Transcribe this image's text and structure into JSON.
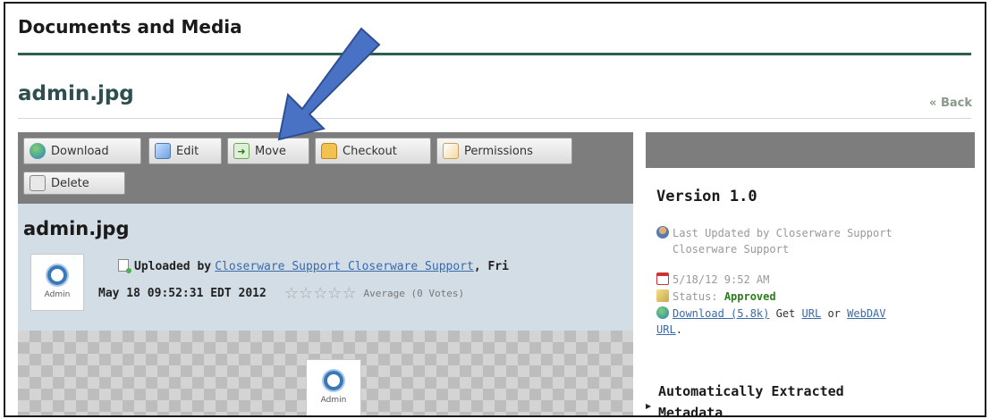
{
  "portlet": {
    "title": "Documents and Media"
  },
  "file": {
    "name": "admin.jpg",
    "back_label": "« Back"
  },
  "toolbar": {
    "download": "Download",
    "edit": "Edit",
    "move": "Move",
    "checkout": "Checkout",
    "permissions": "Permissions",
    "delete": "Delete"
  },
  "info": {
    "title": "admin.jpg",
    "thumb_label": "Admin",
    "uploaded_by_prefix": "Uploaded by",
    "uploader": "Closerware Support Closerware Support",
    "date_part1": ", Fri",
    "date_part2": "May 18 09:52:31 EDT 2012",
    "stars": "☆☆☆☆☆",
    "average": "Average (0 Votes)"
  },
  "preview": {
    "label": "Admin"
  },
  "sidebar": {
    "version": "Version 1.0",
    "last_updated_line1": "Last Updated by Closerware Support",
    "last_updated_line2": "Closerware Support",
    "date": "5/18/12 9:52 AM",
    "status_label": "Status:",
    "status_value": "Approved",
    "download_link": "Download (5.8k)",
    "get_text": "Get",
    "url_link": "URL",
    "or_text": "or",
    "webdav_link": "WebDAV",
    "url_link2": "URL",
    "auto_metadata_line1": "Automatically Extracted",
    "auto_metadata_line2": "Metadata"
  },
  "annotation": {
    "arrow_color": "#4a72c4"
  }
}
